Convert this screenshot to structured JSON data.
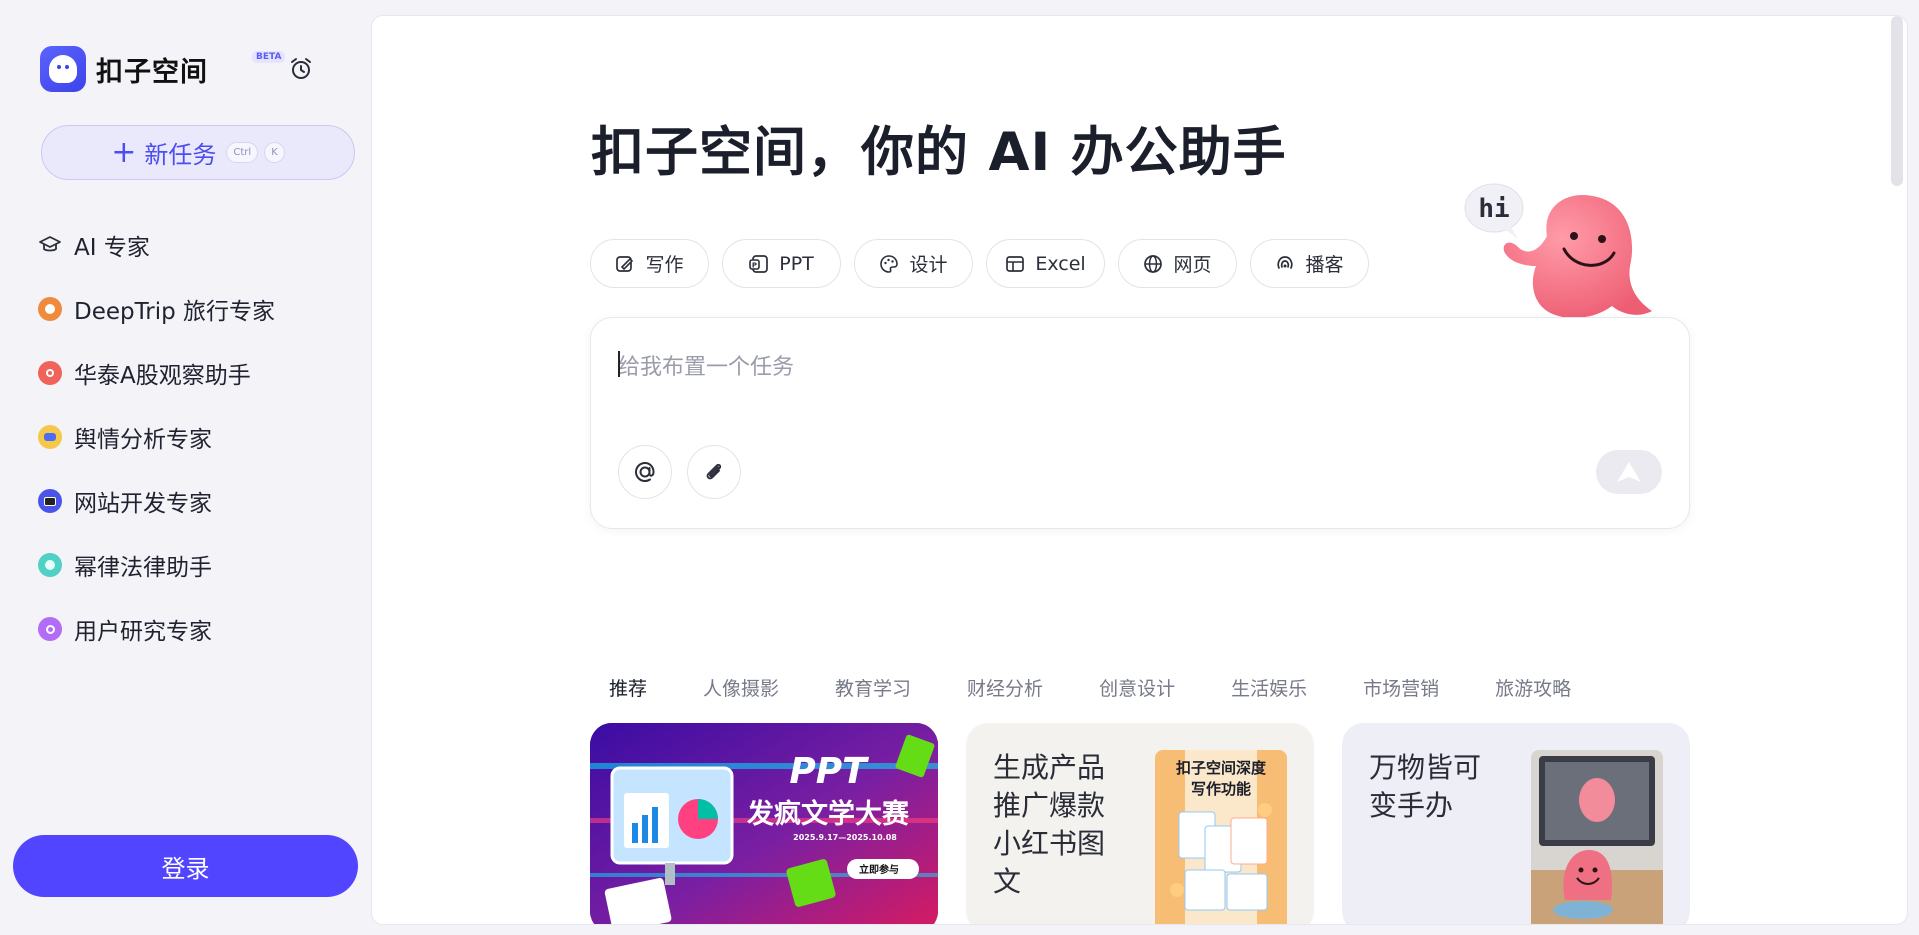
{
  "app": {
    "brand_name": "扣子空间",
    "beta_label": "BETA"
  },
  "sidebar": {
    "new_task_label": "新任务",
    "shortcut_keys": [
      "Ctrl",
      "K"
    ],
    "items": [
      {
        "label": "AI 专家",
        "icon": "graduation-cap-icon"
      },
      {
        "label": "DeepTrip 旅行专家",
        "icon": "deeptrip-avatar-icon"
      },
      {
        "label": "华泰A股观察助手",
        "icon": "huatai-avatar-icon"
      },
      {
        "label": "舆情分析专家",
        "icon": "sentiment-avatar-icon"
      },
      {
        "label": "网站开发专家",
        "icon": "web-dev-avatar-icon"
      },
      {
        "label": "幂律法律助手",
        "icon": "law-avatar-icon"
      },
      {
        "label": "用户研究专家",
        "icon": "user-research-avatar-icon"
      }
    ],
    "login_label": "登录"
  },
  "main": {
    "title": "扣子空间，你的 AI 办公助手",
    "mascot_bubble": "hi",
    "chips": [
      {
        "label": "写作",
        "icon": "write-icon"
      },
      {
        "label": "PPT",
        "icon": "ppt-icon"
      },
      {
        "label": "设计",
        "icon": "palette-icon"
      },
      {
        "label": "Excel",
        "icon": "table-icon"
      },
      {
        "label": "网页",
        "icon": "globe-icon"
      },
      {
        "label": "播客",
        "icon": "podcast-icon"
      }
    ],
    "composer": {
      "placeholder": "给我布置一个任务"
    },
    "tabs": [
      "推荐",
      "人像摄影",
      "教育学习",
      "财经分析",
      "创意设计",
      "生活娱乐",
      "市场营销",
      "旅游攻略"
    ],
    "active_tab": "推荐",
    "cards": [
      {
        "title": "PPT",
        "subtitle": "发疯文学大赛",
        "date": "2025.9.17—2025.10.08",
        "cta": "立即参与"
      },
      {
        "text": "生成产品推广爆款小红书图文",
        "thumb_title": "扣子空间深度写作功能"
      },
      {
        "text": "万物皆可变手办"
      }
    ]
  },
  "colors": {
    "accent": "#5245ff",
    "sidebar_bg": "#f3f3f8",
    "new_task_bg": "#e9e9fb"
  }
}
